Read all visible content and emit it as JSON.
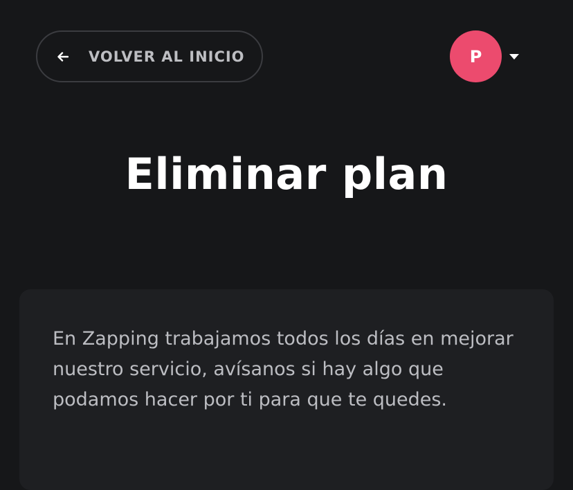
{
  "header": {
    "back_label": "VOLVER AL INICIO",
    "user_initial": "P"
  },
  "main": {
    "title": "Eliminar plan",
    "message": "En Zapping trabajamos todos los días en mejorar nuestro servicio, avísanos si hay algo que podamos hacer por ti para que te quedes."
  },
  "icons": {
    "back": "arrow-left-icon",
    "menu": "caret-down-icon"
  },
  "colors": {
    "background": "#161719",
    "avatar": "#ec4b6e",
    "card": "#1e1f22"
  }
}
